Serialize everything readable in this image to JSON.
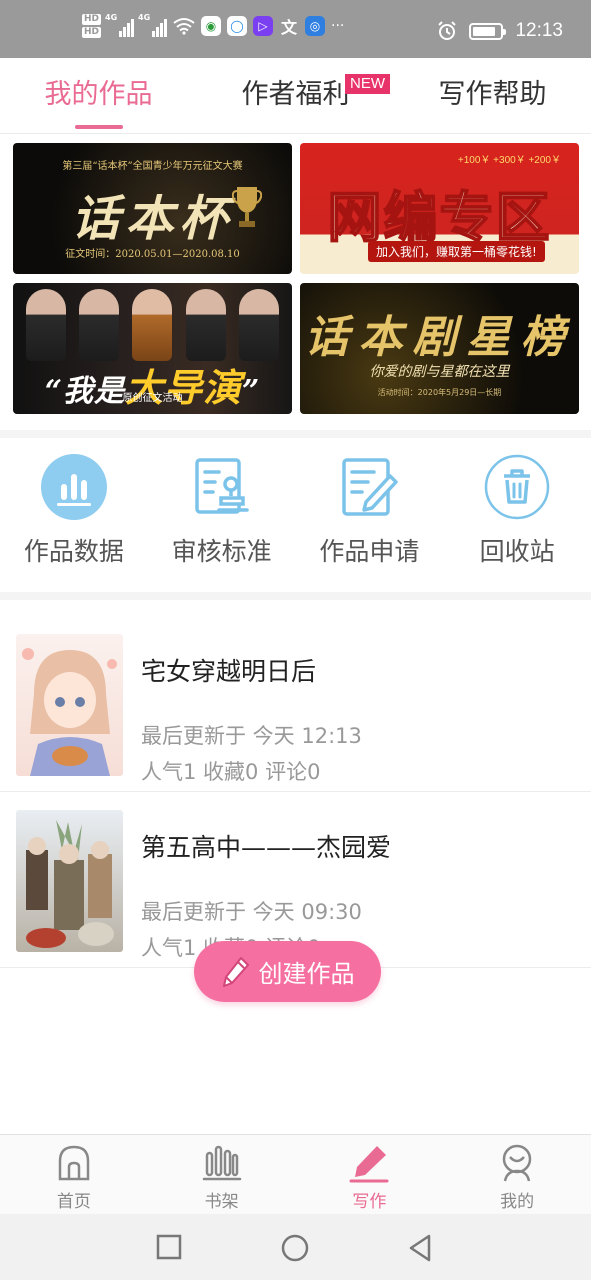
{
  "status_bar": {
    "network_hd_top": "HD",
    "network_hd_bottom": "HD",
    "signal1_tag": "4G",
    "signal2_tag": "4G",
    "more_icon": "···",
    "time": "12:13"
  },
  "top_tabs": [
    {
      "label": "我的作品",
      "active": true
    },
    {
      "label": "作者福利",
      "badge": "NEW"
    },
    {
      "label": "写作帮助"
    }
  ],
  "banners": [
    {
      "small": "第三届“话本杯”全国青少年万元征文大赛",
      "title": "话本杯",
      "date": "征文时间：2020.05.01—2020.08.10"
    },
    {
      "title": "网编专区",
      "sub": "加入我们，赚取第一桶零花钱!",
      "coins": "+100￥ +300￥ +200￥"
    },
    {
      "title_pre": "“我是",
      "title_em": "大导演",
      "title_post": "”",
      "foot": "原创征文活动"
    },
    {
      "title": "话本剧星榜",
      "line": "你爱的剧与星都在这里",
      "date": "活动时间：2020年5月29日—长期"
    }
  ],
  "quick_entries": [
    {
      "label": "作品数据",
      "icon": "bar-chart-icon"
    },
    {
      "label": "审核标准",
      "icon": "review-standard-icon"
    },
    {
      "label": "作品申请",
      "icon": "edit-document-icon"
    },
    {
      "label": "回收站",
      "icon": "trash-icon"
    }
  ],
  "works": [
    {
      "title": "宅女穿越明日后",
      "updated": "最后更新于 今天 12:13",
      "stats": "人气1 收藏0 评论0"
    },
    {
      "title": "第五高中———杰园爱",
      "updated": "最后更新于 今天 09:30",
      "stats": "人气1 收藏0 评论0"
    }
  ],
  "fab": {
    "label": "创建作品"
  },
  "bottom_nav": [
    {
      "label": "首页",
      "icon": "home-icon"
    },
    {
      "label": "书架",
      "icon": "bookshelf-icon"
    },
    {
      "label": "写作",
      "icon": "pen-icon",
      "active": true
    },
    {
      "label": "我的",
      "icon": "profile-icon"
    }
  ],
  "colors": {
    "accent": "#e96b93",
    "fab": "#f56fa0",
    "icon_blue": "#7cc3ea"
  }
}
